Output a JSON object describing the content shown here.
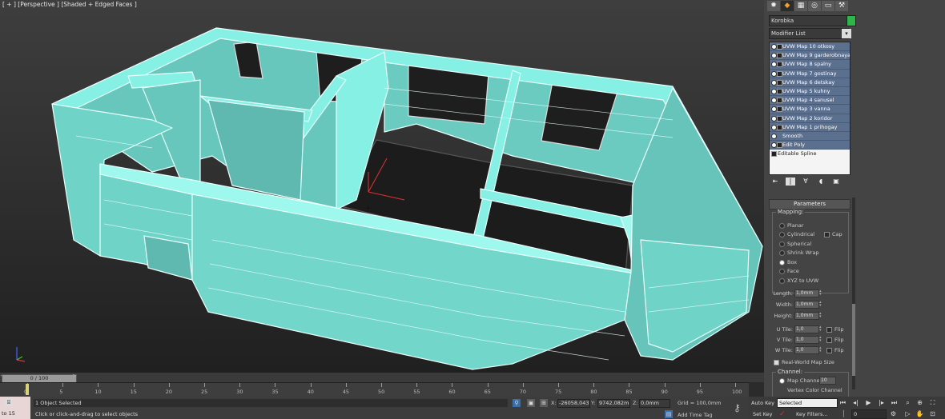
{
  "viewport": {
    "label": "[ + ] [Perspective ] [Shaded + Edged Faces ]",
    "mesh_color": "#7fe8dd",
    "mesh_edge_color": "#e9fffb"
  },
  "command_panel": {
    "tabs": [
      "create-icon",
      "modify-icon",
      "hierarchy-icon",
      "motion-icon",
      "display-icon",
      "utilities-icon"
    ],
    "tab_glyphs": [
      "✹",
      "◆",
      "▦",
      "◎",
      "▭",
      "⚒"
    ],
    "object_name": "Korobka",
    "object_color": "#2fb64a",
    "modifier_list_label": "Modifier List",
    "modifier_stack": [
      "UVW Map 10 otkosy",
      "UVW Map 9 garderobnaya",
      "UVW Map 8 spalny",
      "UVW Map 7 gostinay",
      "UVW Map 6 detskay",
      "UVW Map 5 kuhny",
      "UVW Map 4 sanusel",
      "UVW Map 3 vanna",
      "UVW Map 2 koridor",
      "UVW Map 1 prihogay",
      "Smooth",
      "Edit Poly"
    ],
    "base_object": "Editable Spline",
    "stack_tool_glyphs": [
      "⇤",
      "|",
      "∀",
      "◖",
      "▣"
    ]
  },
  "parameters": {
    "title": "Parameters",
    "mapping_label": "Mapping:",
    "mapping_options": [
      "Planar",
      "Cylindrical",
      "Spherical",
      "Shrink Wrap",
      "Box",
      "Face",
      "XYZ to UVW"
    ],
    "selected_mapping": "Box",
    "cap_label": "Cap",
    "length_label": "Length:",
    "length_value": "1,0mm",
    "width_label": "Width:",
    "width_value": "1,0mm",
    "height_label": "Height:",
    "height_value": "1,0mm",
    "u_tile_label": "U Tile:",
    "u_tile_value": "1,0",
    "v_tile_label": "V Tile:",
    "v_tile_value": "1,0",
    "w_tile_label": "W Tile:",
    "w_tile_value": "1,0",
    "flip_label": "Flip",
    "real_world_label": "Real-World Map Size",
    "real_world_checked": true,
    "channel_label": "Channel:",
    "map_channel_label": "Map Channel:",
    "map_channel_value": "10",
    "vertex_color_label": "Vertex Color Channel"
  },
  "timeline": {
    "slider_label": "0 / 100",
    "ticks": [
      0,
      5,
      10,
      15,
      20,
      25,
      30,
      35,
      40,
      45,
      50,
      55,
      60,
      65,
      70,
      75,
      80,
      85,
      90,
      95,
      100
    ],
    "current_frame": 0
  },
  "status_bar": {
    "maxscript_text": "to 15",
    "selection_text": "1 Object Selected",
    "prompt_text": "Click or click-and-drag to select objects",
    "x_label": "X:",
    "x_value": "-26058,043",
    "y_label": "Y:",
    "y_value": "9742,082m",
    "z_label": "Z:",
    "z_value": "0,0mm",
    "grid_text": "Grid = 100,0mm",
    "add_time_tag": "Add Time Tag"
  },
  "anim_controls": {
    "auto_key": "Auto Key",
    "set_key": "Set Key",
    "selected_option": "Selected",
    "key_filters": "Key Filters...",
    "frame_value": "0",
    "playback_glyphs": [
      "⏮",
      "◂|",
      "▶",
      "|▸",
      "⏭"
    ]
  }
}
